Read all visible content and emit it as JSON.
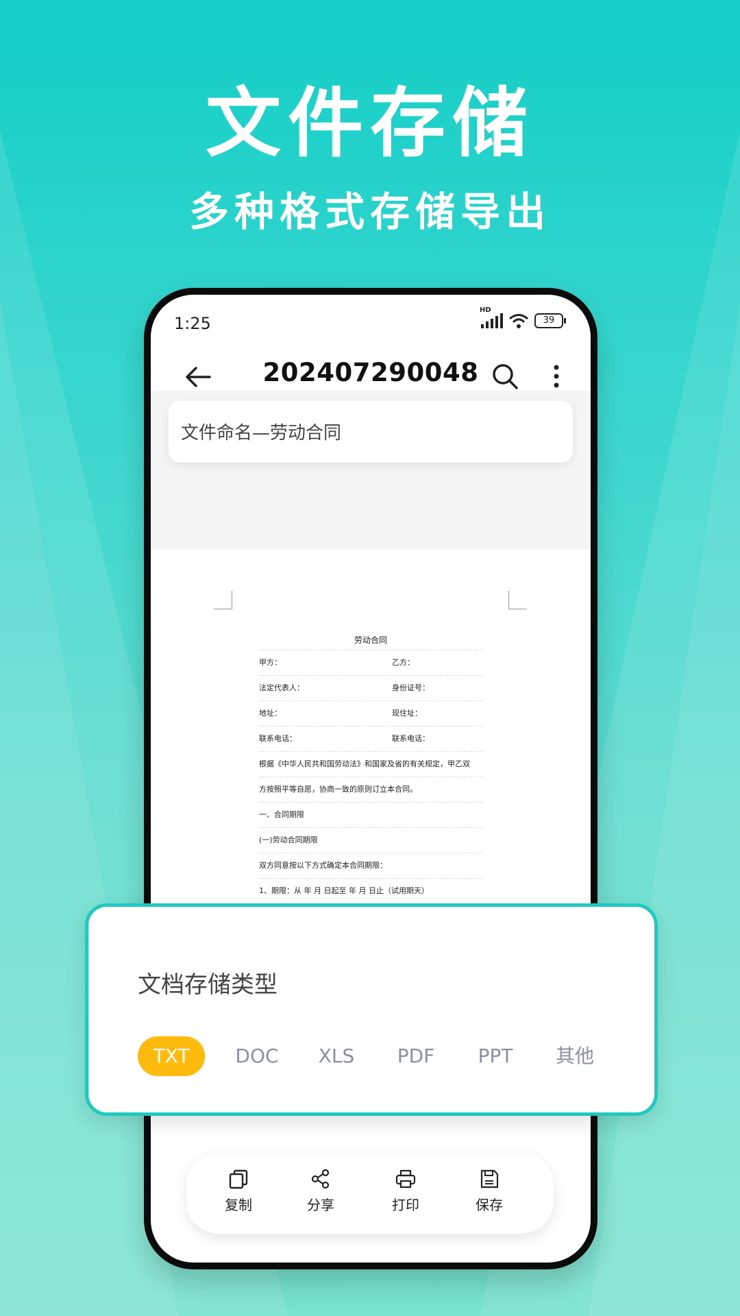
{
  "hero": {
    "title": "文件存储",
    "subtitle": "多种格式存储导出"
  },
  "status_bar": {
    "time": "1:25",
    "signal_label": "HD",
    "battery": "39",
    "icons": [
      "signal-icon",
      "wifi-icon",
      "battery-icon"
    ]
  },
  "app_bar": {
    "title": "202407290048",
    "icons": [
      "back-arrow-icon",
      "search-icon",
      "more-vertical-icon"
    ]
  },
  "file_name_card": {
    "text": "文件命名—劳动合同"
  },
  "contract": {
    "title": "劳动合同",
    "rows": [
      [
        "甲方：",
        "乙方："
      ],
      [
        "法定代表人：",
        "身份证号："
      ],
      [
        "地址：",
        "现住址："
      ],
      [
        "联系电话：",
        "联系电话："
      ]
    ],
    "lines": [
      "根据《中华人民共和国劳动法》和国家及省的有关规定，甲乙双",
      "方按照平等自愿，协商一致的原则订立本合同。",
      "一、合同期限",
      "(一)劳动合同期限",
      "双方同意按以下方式确定本合同期限：",
      "1、期限：从  年  月  日起至  年  月  日止（试用期天）"
    ]
  },
  "storage_type": {
    "title": "文档存储类型",
    "formats": [
      "TXT",
      "DOC",
      "XLS",
      "PDF",
      "PPT",
      "其他"
    ],
    "selected": "TXT",
    "accent_color": "#ffbb0d",
    "border_color": "#1fc9bd"
  },
  "toolbar": {
    "items": [
      {
        "label": "复制",
        "icon": "copy-icon"
      },
      {
        "label": "分享",
        "icon": "share-icon"
      },
      {
        "label": "打印",
        "icon": "print-icon"
      },
      {
        "label": "保存",
        "icon": "save-icon"
      }
    ]
  }
}
